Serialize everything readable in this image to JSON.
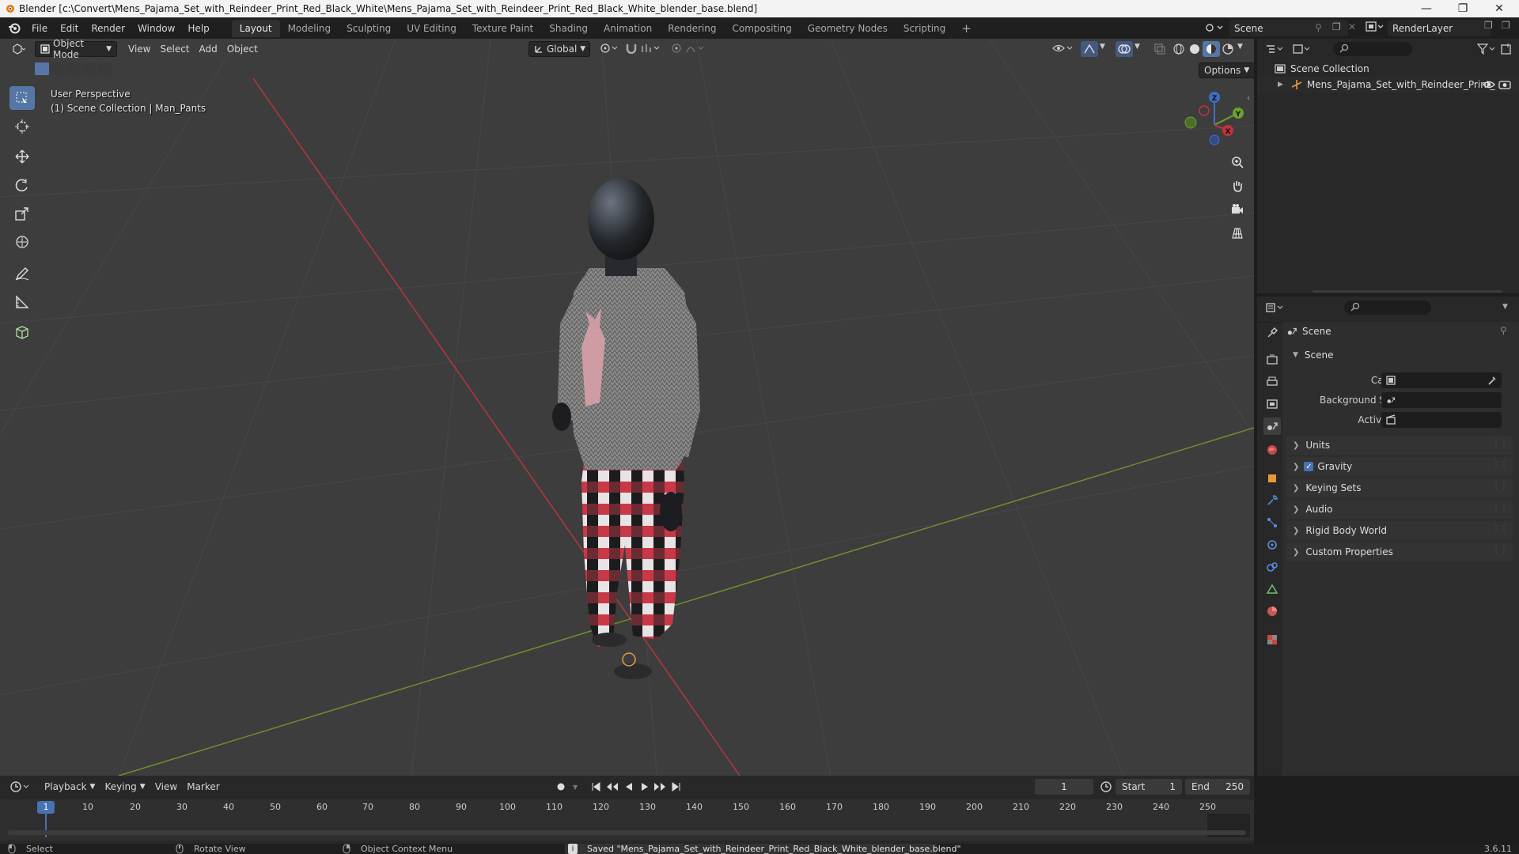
{
  "window": {
    "title": "Blender [c:\\Convert\\Mens_Pajama_Set_with_Reindeer_Print_Red_Black_White\\Mens_Pajama_Set_with_Reindeer_Print_Red_Black_White_blender_base.blend]",
    "controls": [
      "minimize",
      "maximize",
      "close"
    ]
  },
  "menu": [
    "File",
    "Edit",
    "Render",
    "Window",
    "Help"
  ],
  "workspaces": {
    "tabs": [
      "Layout",
      "Modeling",
      "Sculpting",
      "UV Editing",
      "Texture Paint",
      "Shading",
      "Animation",
      "Rendering",
      "Compositing",
      "Geometry Nodes",
      "Scripting"
    ],
    "active": "Layout",
    "add": "+"
  },
  "scene_selector": {
    "value": "Scene"
  },
  "layer_selector": {
    "value": "RenderLayer"
  },
  "viewport": {
    "mode": "Object Mode",
    "menus": [
      "View",
      "Select",
      "Add",
      "Object"
    ],
    "transform_orientation": "Global",
    "options_label": "Options",
    "overlay_line1": "User Perspective",
    "overlay_line2": "(1) Scene Collection | Man_Pants",
    "axes": {
      "x": "X",
      "y": "Y",
      "z": "Z"
    },
    "colors": {
      "x_axis": "#b5373d",
      "y_axis": "#6f8f2f",
      "background": "#3d3d3d",
      "accent": "#5677a6"
    }
  },
  "tools": [
    "select-box",
    "cursor",
    "move",
    "rotate",
    "scale",
    "transform",
    "annotate",
    "measure",
    "add-cube"
  ],
  "outliner": {
    "root": "Scene Collection",
    "items": [
      {
        "label": "Mens_Pajama_Set_with_Reindeer_Print_"
      }
    ]
  },
  "properties": {
    "header": "Scene",
    "section": "Scene",
    "fields": [
      {
        "label": "Camera",
        "value": ""
      },
      {
        "label": "Background Scene",
        "value": ""
      },
      {
        "label": "Active Clip",
        "value": ""
      }
    ],
    "panels": [
      {
        "label": "Units",
        "checkbox": false
      },
      {
        "label": "Gravity",
        "checkbox": true,
        "checked": true
      },
      {
        "label": "Keying Sets",
        "checkbox": false
      },
      {
        "label": "Audio",
        "checkbox": false
      },
      {
        "label": "Rigid Body World",
        "checkbox": false
      },
      {
        "label": "Custom Properties",
        "checkbox": false
      }
    ]
  },
  "timeline": {
    "menus": [
      "Playback",
      "Keying",
      "View",
      "Marker"
    ],
    "current_frame": "1",
    "start_label": "Start",
    "start_value": "1",
    "end_label": "End",
    "end_value": "250",
    "ticks": [
      "1",
      "10",
      "20",
      "30",
      "40",
      "50",
      "60",
      "70",
      "80",
      "90",
      "100",
      "110",
      "120",
      "130",
      "140",
      "150",
      "160",
      "170",
      "180",
      "190",
      "200",
      "210",
      "220",
      "230",
      "240",
      "250"
    ]
  },
  "status": {
    "select": "Select",
    "rotate": "Rotate View",
    "context": "Object Context Menu",
    "message": "Saved \"Mens_Pajama_Set_with_Reindeer_Print_Red_Black_White_blender_base.blend\"",
    "version": "3.6.11"
  }
}
